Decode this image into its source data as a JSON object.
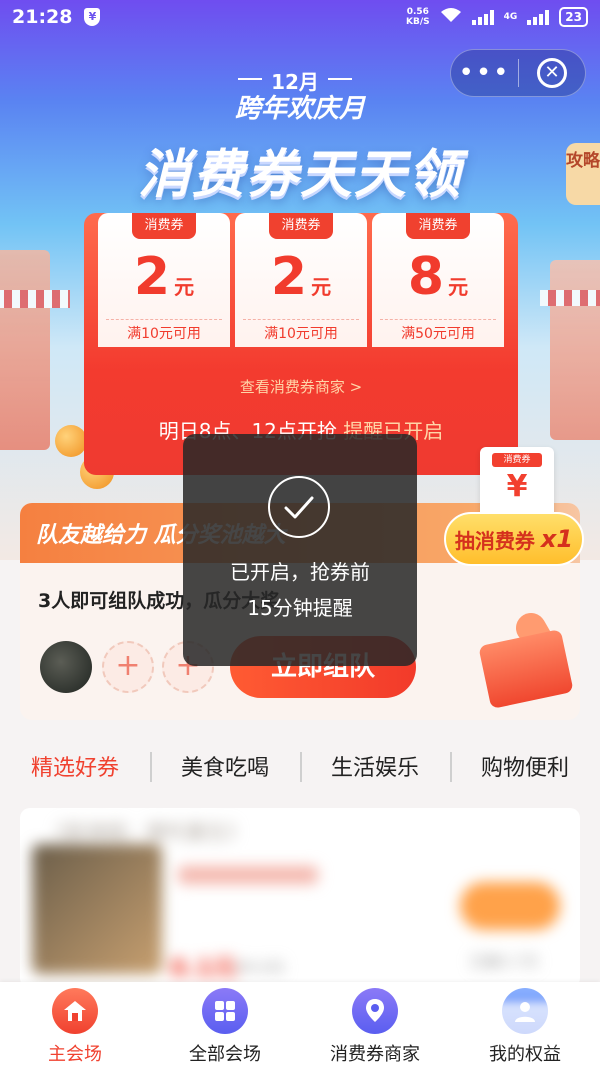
{
  "status_bar": {
    "time": "21:28",
    "network_speed_value": "0.56",
    "network_speed_unit": "KB/S",
    "signal_label": "4G",
    "battery": "23"
  },
  "capsule": {
    "more_label": "•••",
    "close_label": "✕"
  },
  "hero": {
    "month": "12月",
    "festival": "跨年欢庆月",
    "headline": "消费券天天领",
    "tips_tag": "攻略"
  },
  "coupons": [
    {
      "tag": "消费券",
      "amount": "2",
      "unit": "元",
      "condition": "满10元可用"
    },
    {
      "tag": "消费券",
      "amount": "2",
      "unit": "元",
      "condition": "满10元可用"
    },
    {
      "tag": "消费券",
      "amount": "8",
      "unit": "元",
      "condition": "满50元可用"
    }
  ],
  "coupon_panel": {
    "merchants_link": "查看消费券商家 >",
    "schedule": "明日8点、12点开抢",
    "reminder": "提醒已开启"
  },
  "lottery": {
    "ticket_tag": "消费券",
    "ticket_symbol": "¥",
    "label": "抽消费券",
    "count": "x1"
  },
  "team": {
    "banner_title": "队友越给力 瓜分奖池越大",
    "subtitle": "3人即可组队成功，瓜分大奖",
    "slot_plus": "+",
    "join_button": "立即组队"
  },
  "tabs": [
    "精选好券",
    "美食吃喝",
    "生活娱乐",
    "购物便利"
  ],
  "content": {
    "film_title": "《新神榜：哪吒重生》",
    "price": "0.1元",
    "old_price": "60.2元",
    "sold": "已售5.7万"
  },
  "toast": {
    "line1": "已开启，抢券前",
    "line2": "15分钟提醒"
  },
  "bottom_nav": [
    {
      "label": "主会场",
      "icon": "home-icon"
    },
    {
      "label": "全部会场",
      "icon": "grid-icon"
    },
    {
      "label": "消费券商家",
      "icon": "location-pin-icon"
    },
    {
      "label": "我的权益",
      "icon": "user-icon"
    }
  ],
  "colors": {
    "accent_red": "#f0412f",
    "gold": "#ffbe2c",
    "nav_purple": "#5a5ef0"
  }
}
